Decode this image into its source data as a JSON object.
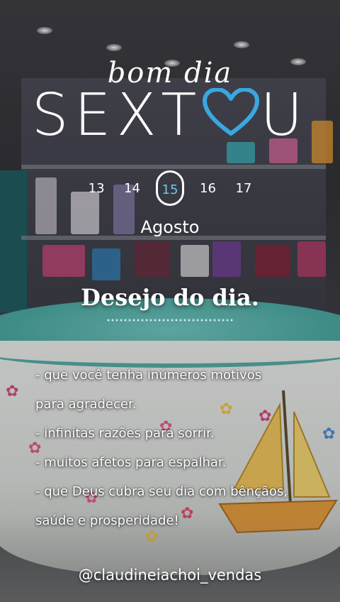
{
  "header": {
    "script_title": "bom dia",
    "title_prefix": "SEXT",
    "title_suffix": "U",
    "heart_color": "#3aa7e0"
  },
  "calendar": {
    "days": [
      "13",
      "14",
      "15",
      "16",
      "17"
    ],
    "selected_index": 2,
    "month": "Agosto"
  },
  "wish": {
    "title": "Desejo do dia.",
    "lines": [
      "- que você  tenha inúmeros motivos",
      "para agradecer.",
      "- infinitas razões para sorrir.",
      "- muitos afetos para espalhar.",
      "- que Deus cubra seu dia com bênçãos,",
      "saúde e prosperidade!"
    ]
  },
  "footer": {
    "handle": "@claudineiachoi_vendas"
  },
  "colors": {
    "accent_blue": "#6dc8f0",
    "lid_teal": "#4aa8a0"
  }
}
